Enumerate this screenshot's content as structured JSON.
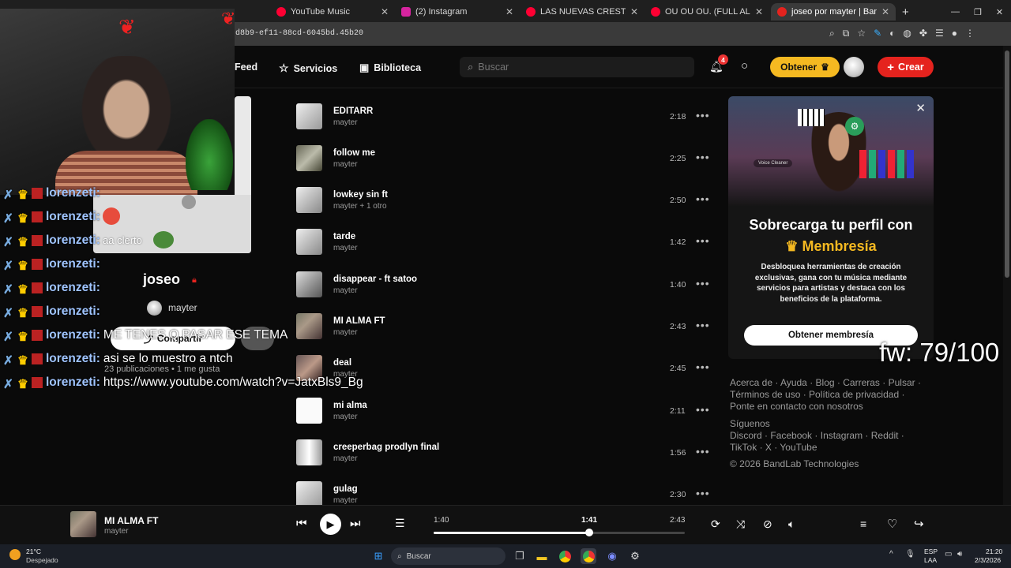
{
  "browser": {
    "tabs": [
      {
        "label": "YouTube Music",
        "color": "#ff0033"
      },
      {
        "label": "(2) Instagram",
        "color": "#d6249f"
      },
      {
        "label": "LAS NUEVAS CRESTAS (TEENX)",
        "color": "#ff0033"
      },
      {
        "label": "OU OU OU. (FULL ALBUM) - Yo",
        "color": "#ff0033"
      },
      {
        "label": "joseo por mayter | BandLab",
        "color": "#e5231e"
      }
    ],
    "url": "d8b9-ef11-88cd-6045bd.45b20"
  },
  "nav": {
    "feed": "Feed",
    "servicios": "Servicios",
    "biblioteca": "Biblioteca",
    "search_placeholder": "Buscar",
    "notifications": "4",
    "obtener": "Obtener",
    "crear": "Crear"
  },
  "tracks": [
    {
      "title": "EDITARR",
      "artist": "mayter",
      "duration": "2:18"
    },
    {
      "title": "follow me",
      "artist": "mayter",
      "duration": "2:25"
    },
    {
      "title": "lowkey sin ft",
      "artist": "mayter + 1 otro",
      "duration": "2:50"
    },
    {
      "title": "tarde",
      "artist": "mayter",
      "duration": "1:42"
    },
    {
      "title": "disappear - ft satoo",
      "artist": "mayter",
      "duration": "1:40"
    },
    {
      "title": "MI ALMA FT",
      "artist": "mayter",
      "duration": "2:43"
    },
    {
      "title": "deal",
      "artist": "mayter",
      "duration": "2:45"
    },
    {
      "title": "mi alma",
      "artist": "mayter",
      "duration": "2:11"
    },
    {
      "title": "creeperbag prodlyn final",
      "artist": "mayter",
      "duration": "1:56"
    },
    {
      "title": "gulag",
      "artist": "mayter",
      "duration": "2:30"
    }
  ],
  "promo": {
    "title_line1": "Sobrecarga tu perfil con",
    "title_line2": "Membresía",
    "body": "Desbloquea herramientas de creación exclusivas, gana con tu música mediante servicios para artistas y destaca con los beneficios de la plataforma.",
    "button": "Obtener membresía",
    "image_label": "Voice Cleaner"
  },
  "footer": {
    "links1": [
      "Acerca de",
      "Ayuda",
      "Blog",
      "Carreras",
      "Pulsar"
    ],
    "links2": [
      "Términos de uso",
      "Política de privacidad"
    ],
    "links3": [
      "Ponte en contacto con nosotros"
    ],
    "siguenos": "Síguenos",
    "social1": [
      "Discord",
      "Facebook",
      "Instagram",
      "Reddit"
    ],
    "social2": [
      "TikTok",
      "X",
      "YouTube"
    ],
    "copyright": "© 2026 BandLab Technologies"
  },
  "player": {
    "title": "MI ALMA FT",
    "artist": "mayter",
    "time_start": "1:40",
    "time_current": "1:41",
    "time_end": "2:43",
    "progress": 0.62
  },
  "overlay": {
    "profile_name": "joseo",
    "profile_user": "mayter",
    "share": "Compartir",
    "pubs": "23 publicaciones  •  1 me gusta",
    "card_text": "aa clerto",
    "fw": "fw: 79/100",
    "chat": [
      {
        "name": "lorenzeti:",
        "msg": ""
      },
      {
        "name": "lorenzeti:",
        "msg": ""
      },
      {
        "name": "lorenzeti:",
        "msg": ""
      },
      {
        "name": "lorenzeti:",
        "msg": ""
      },
      {
        "name": "lorenzeti:",
        "msg": ""
      },
      {
        "name": "lorenzeti:",
        "msg": "ME TENES Q PASAR ESE TEMA"
      },
      {
        "name": "lorenzeti:",
        "msg": "asi se lo muestro a ntch"
      },
      {
        "name": "lorenzeti:",
        "msg": "https://www.youtube.com/watch?v=JatxBls9_Bg"
      }
    ]
  },
  "taskbar": {
    "weather_temp": "21°C",
    "weather_text": "Despejado",
    "search": "Buscar",
    "lang1": "ESP",
    "lang2": "LAA",
    "time": "21:20",
    "date": "2/3/2026"
  }
}
